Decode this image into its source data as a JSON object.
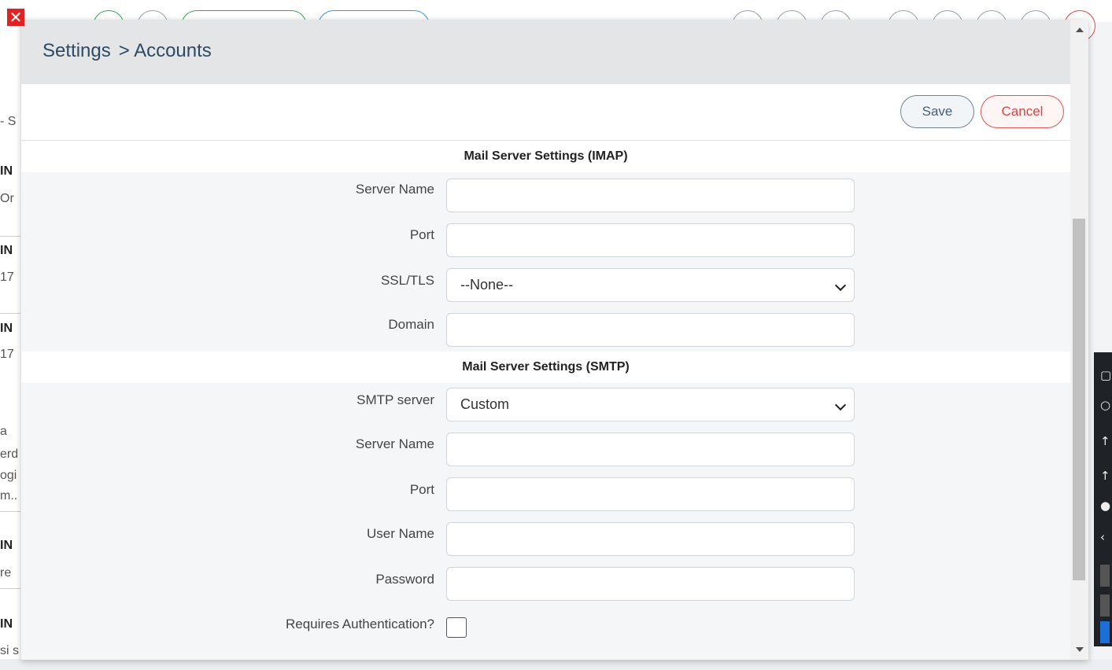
{
  "breadcrumb": {
    "section": "Settings",
    "page": "> Accounts"
  },
  "toolbar": {
    "save_label": "Save",
    "cancel_label": "Cancel"
  },
  "imap": {
    "title": "Mail Server Settings (IMAP)",
    "server_name_label": "Server Name",
    "server_name_value": "",
    "port_label": "Port",
    "port_value": "",
    "ssl_label": "SSL/TLS",
    "ssl_value": "--None--",
    "domain_label": "Domain",
    "domain_value": ""
  },
  "smtp": {
    "title": "Mail Server Settings (SMTP)",
    "smtp_server_label": "SMTP server",
    "smtp_server_value": "Custom",
    "server_name_label": "Server Name",
    "server_name_value": "",
    "port_label": "Port",
    "port_value": "",
    "user_name_label": "User Name",
    "user_name_value": "",
    "password_label": "Password",
    "password_value": "",
    "requires_auth_label": "Requires Authentication?",
    "requires_auth_checked": false
  },
  "background": {
    "fragments": [
      "- S",
      "IN",
      "Or",
      "IN",
      "17",
      "IN",
      "17",
      "a",
      "erd",
      "ogi",
      "m..",
      "IN",
      "re",
      "IN",
      "si s"
    ]
  },
  "colors": {
    "save_border": "#6f8597",
    "cancel_border": "#e05555",
    "close_red": "#e02222"
  }
}
